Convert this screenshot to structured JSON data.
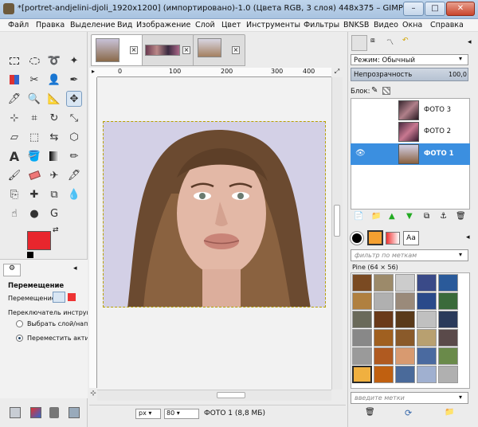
{
  "window": {
    "title": "*[portret-andjelini-djoli_1920x1200] (импортировано)-1.0 (Цвета RGB, 3 слоя) 448x375 – GIMP",
    "minimize": "–",
    "maximize": "□",
    "close": "✕"
  },
  "menu": [
    "Файл",
    "Правка",
    "Выделение",
    "Вид",
    "Изображение",
    "Слой",
    "Цвет",
    "Инструменты",
    "Фильтры",
    "BNKSB",
    "Видео",
    "Окна",
    "Справка"
  ],
  "tool_options": {
    "title": "Перемещение",
    "move_label": "Перемещение:",
    "toggle_label": "Переключатель инструмен",
    "option1": "Выбрать слой/напр",
    "option2": "Переместить актив"
  },
  "ruler": {
    "marks": [
      "0",
      "100",
      "200",
      "300",
      "400"
    ]
  },
  "status": {
    "unit": "px",
    "zoom": "80",
    "layer_info": "ФОТО 1 (8,8 МБ)"
  },
  "layers_panel": {
    "mode_label": "Режим:",
    "mode_value": "Обычный",
    "opacity_label": "Непрозрачность",
    "opacity_value": "100,0",
    "lock_label": "Блок:",
    "layers": [
      {
        "name": "ФОТО 3",
        "selected": false
      },
      {
        "name": "ФОТО 2",
        "selected": false
      },
      {
        "name": "ФОТО 1",
        "selected": true
      }
    ]
  },
  "patterns_panel": {
    "filter_placeholder": "фильтр по меткам",
    "current_pattern": "Pine (64 × 56)",
    "tags_placeholder": "введите метки",
    "tab_text": "Aa"
  },
  "colors": {
    "foreground": "#e8262d",
    "background": "#ffffff",
    "selection": "#3b8fe0"
  }
}
